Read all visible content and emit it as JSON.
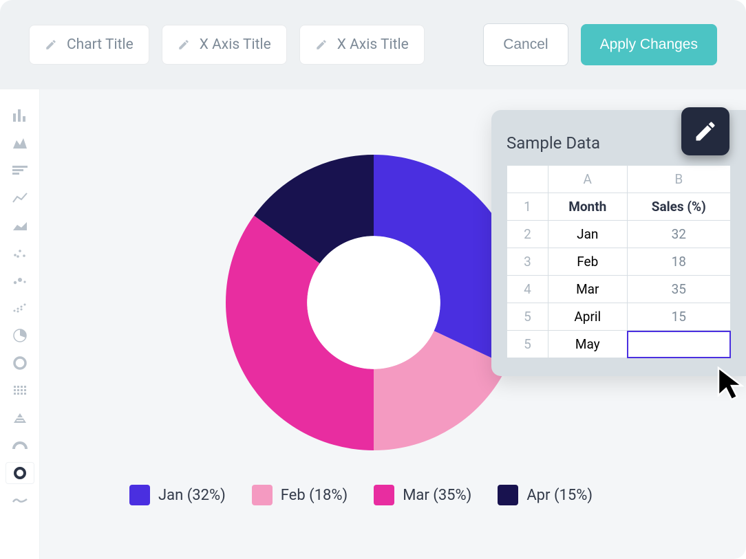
{
  "topbar": {
    "chart_title_placeholder": "Chart Title",
    "x_axis_title_1_placeholder": "X Axis Title",
    "x_axis_title_2_placeholder": "X Axis Title",
    "cancel_label": "Cancel",
    "apply_label": "Apply Changes"
  },
  "sidebar": {
    "items": [
      {
        "name": "bar-chart-icon"
      },
      {
        "name": "area-chart-icon"
      },
      {
        "name": "stacked-bar-icon"
      },
      {
        "name": "line-chart-icon"
      },
      {
        "name": "stacked-area-icon"
      },
      {
        "name": "scatter-plot-icon"
      },
      {
        "name": "bubble-chart-icon"
      },
      {
        "name": "dot-matrix-icon"
      },
      {
        "name": "pie-chart-icon"
      },
      {
        "name": "donut-chart-icon"
      },
      {
        "name": "grid-icon"
      },
      {
        "name": "pyramid-icon"
      },
      {
        "name": "gauge-icon"
      },
      {
        "name": "ring-chart-icon"
      },
      {
        "name": "sparkline-icon"
      }
    ],
    "active_index": 13
  },
  "panel": {
    "title": "Sample Data",
    "col_a": "A",
    "col_b": "B",
    "header_a": "Month",
    "header_b": "Sales (%)",
    "rows": [
      {
        "num": "1",
        "a": "Month",
        "b": "Sales (%)"
      },
      {
        "num": "2",
        "a": "Jan",
        "b": "32"
      },
      {
        "num": "3",
        "a": "Feb",
        "b": "18"
      },
      {
        "num": "4",
        "a": "Mar",
        "b": "35"
      },
      {
        "num": "5",
        "a": "April",
        "b": "15"
      },
      {
        "num": "5",
        "a": "May",
        "b": ""
      }
    ]
  },
  "legend": {
    "items": [
      {
        "label": "Jan (32%)",
        "color": "#4a2fe0"
      },
      {
        "label": "Feb (18%)",
        "color": "#f49ac1"
      },
      {
        "label": "Mar (35%)",
        "color": "#e82da0"
      },
      {
        "label": "Apr (15%)",
        "color": "#18124f"
      }
    ]
  },
  "chart_data": {
    "type": "pie",
    "title": "",
    "series": [
      {
        "name": "Jan",
        "value": 32,
        "color": "#4a2fe0"
      },
      {
        "name": "Feb",
        "value": 18,
        "color": "#f49ac1"
      },
      {
        "name": "Mar",
        "value": 35,
        "color": "#e82da0"
      },
      {
        "name": "Apr",
        "value": 15,
        "color": "#18124f"
      }
    ],
    "donut_inner_ratio": 0.45
  }
}
